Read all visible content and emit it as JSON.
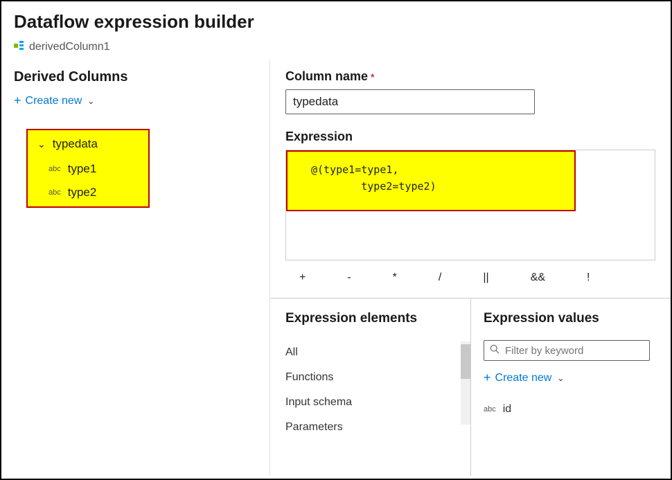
{
  "header": {
    "title": "Dataflow expression builder",
    "step_name": "derivedColumn1"
  },
  "left": {
    "section_title": "Derived Columns",
    "create_new_label": "Create new",
    "tree": {
      "parent": "typedata",
      "children": [
        {
          "type_icon": "abc",
          "name": "type1"
        },
        {
          "type_icon": "abc",
          "name": "type2"
        }
      ]
    }
  },
  "right": {
    "column_name_label": "Column name",
    "column_name_value": "typedata",
    "expression_label": "Expression",
    "expression_text": "@(type1=type1,\n        type2=type2)"
  },
  "operators": {
    "plus": "+",
    "minus": "-",
    "mult": "*",
    "div": "/",
    "or": "||",
    "and": "&&",
    "not": "!"
  },
  "elements": {
    "heading": "Expression elements",
    "items": [
      "All",
      "Functions",
      "Input schema",
      "Parameters"
    ]
  },
  "values": {
    "heading": "Expression values",
    "filter_placeholder": "Filter by keyword",
    "create_new_label": "Create new",
    "items": [
      {
        "type_icon": "abc",
        "name": "id"
      }
    ]
  }
}
